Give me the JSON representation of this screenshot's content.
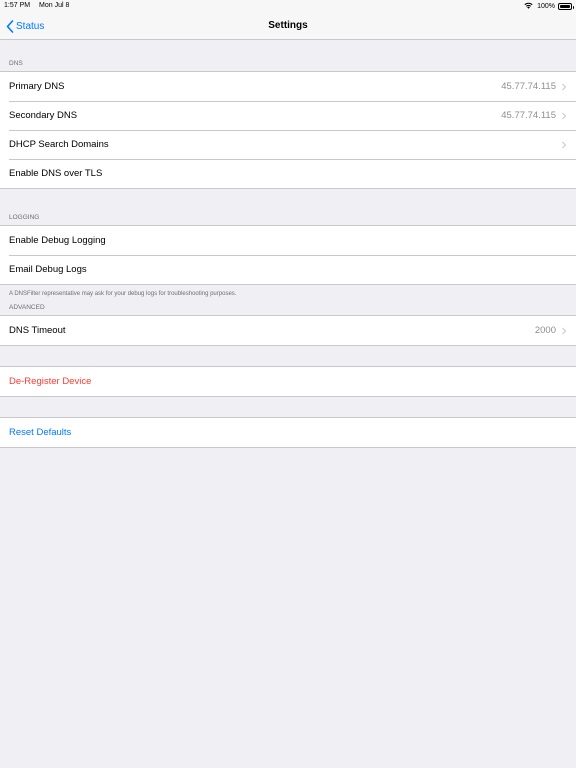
{
  "status_bar": {
    "time": "1:57 PM",
    "date": "Mon Jul 8",
    "battery_pct": "100%",
    "battery_level": 1.0
  },
  "nav": {
    "back_label": "Status",
    "title": "Settings"
  },
  "sections": {
    "dns": {
      "header": "DNS",
      "rows": [
        {
          "label": "Primary DNS",
          "value": "45.77.74.115"
        },
        {
          "label": "Secondary DNS",
          "value": "45.77.74.115"
        },
        {
          "label": "DHCP Search Domains"
        },
        {
          "label": "Enable DNS over TLS"
        }
      ]
    },
    "logging": {
      "header": "LOGGING",
      "rows": [
        {
          "label": "Enable Debug Logging"
        },
        {
          "label": "Email Debug Logs"
        }
      ],
      "footer": "A DNSFilter representative may ask for your debug logs for troubleshooting purposes."
    },
    "advanced": {
      "header": "ADVANCED",
      "rows": [
        {
          "label": "DNS Timeout",
          "value": "2000"
        }
      ]
    },
    "deregister": {
      "label": "De-Register Device"
    },
    "reset": {
      "label": "Reset Defaults"
    }
  },
  "colors": {
    "accent": "#007aff",
    "destructive": "#ff3b30",
    "background": "#efeff4",
    "secondary_text": "#8e8e93"
  },
  "icons": {
    "back": "chevron-left-icon",
    "disclosure": "chevron-right-icon",
    "wifi": "wifi-icon",
    "battery": "battery-icon"
  }
}
